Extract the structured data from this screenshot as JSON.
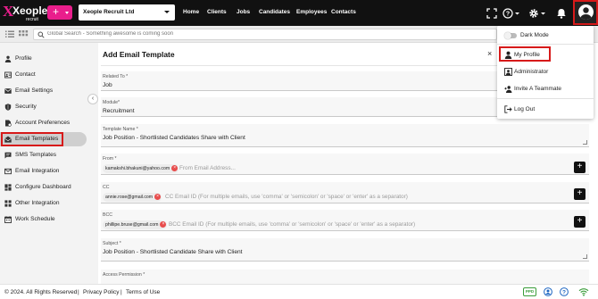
{
  "brand": {
    "logo_text": "Xeople",
    "logo_subtext": "recruit"
  },
  "header": {
    "company": "Xeople Recruit Ltd",
    "nav": [
      "Home",
      "Clients",
      "Jobs",
      "Candidates",
      "Employees",
      "Contacts"
    ],
    "icons": [
      "expand-icon",
      "help-icon",
      "gear-icon",
      "bell-icon",
      "user-avatar"
    ]
  },
  "search": {
    "placeholder": "Global Search - Something awesome is coming soon"
  },
  "sidebar": {
    "items": [
      {
        "label": "Profile",
        "icon": "user-icon"
      },
      {
        "label": "Contact",
        "icon": "contact-card-icon"
      },
      {
        "label": "Email Settings",
        "icon": "mail-icon"
      },
      {
        "label": "Security",
        "icon": "shield-icon"
      },
      {
        "label": "Account Preferences",
        "icon": "preferences-icon"
      },
      {
        "label": "Email Templates",
        "icon": "mail-open-icon",
        "active": true
      },
      {
        "label": "SMS Templates",
        "icon": "sms-icon"
      },
      {
        "label": "Email Integration",
        "icon": "mail-integration-icon"
      },
      {
        "label": "Configure Dashboard",
        "icon": "dashboard-icon"
      },
      {
        "label": "Other Integration",
        "icon": "integration-icon"
      },
      {
        "label": "Work Schedule",
        "icon": "calendar-icon"
      }
    ]
  },
  "main": {
    "title": "Add Email Template",
    "close_label": "×",
    "fields": {
      "related_to": {
        "label": "Related To *",
        "value": "Job"
      },
      "module": {
        "label": "Module*",
        "value": "Recruitment"
      },
      "template_name": {
        "label": "Template Name *",
        "value": "Job Position - Shortlisted Candidates Share with Client"
      },
      "from": {
        "label": "From *",
        "chip": "kamakshi.bhakuni@yahoo.com",
        "placeholder": "From Email Address..."
      },
      "cc": {
        "label": "CC",
        "chip": "annie.rose@gmail.com",
        "placeholder": "CC Email ID (For multiple emails, use 'comma' or 'semicolon' or 'space' or 'enter' as a separator)"
      },
      "bcc": {
        "label": "BCC",
        "chip": "phillipe.bruse@gmail.com",
        "placeholder": "BCC Email ID (For multiple emails, use 'comma' or 'semicolon' or 'space' or 'enter' as a separator)"
      },
      "subject": {
        "label": "Subject *",
        "value": "Job Position - Shortlisted Candidate Share with Client"
      },
      "access_permission": {
        "label": "Access Permission *"
      }
    }
  },
  "dropdown": {
    "dark_mode": "Dark Mode",
    "my_profile": "My Profile",
    "administrator": "Administrator",
    "invite": "Invite A Teammate",
    "logout": "Log Out"
  },
  "footer": {
    "copyright": "© 2024. All Rights Reserved",
    "sep": "|",
    "privacy": "Privacy Policy",
    "terms": "Terms of Use",
    "badge": "PPD"
  },
  "colors": {
    "brand_pink": "#e91e8c",
    "highlight_red": "#d71a1a",
    "topbar": "#111111"
  }
}
